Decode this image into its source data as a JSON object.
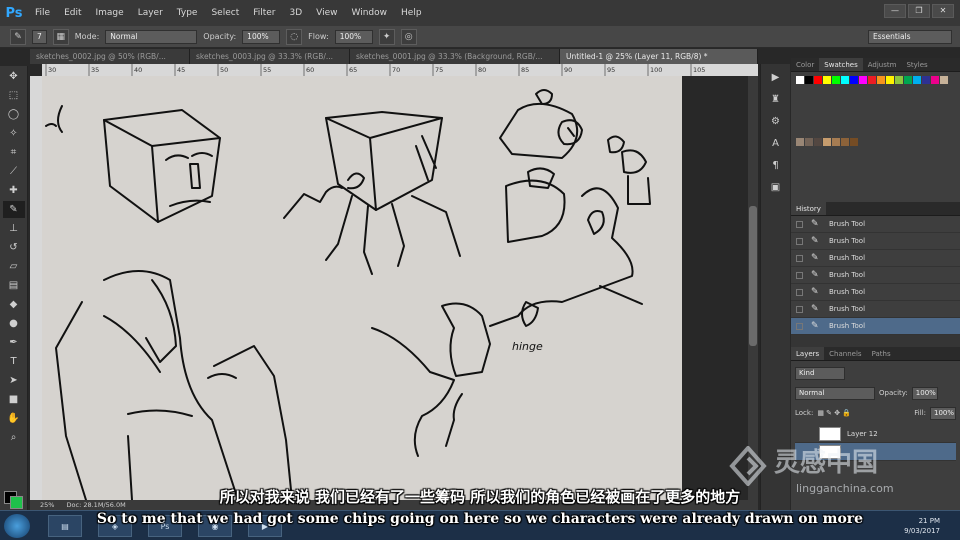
{
  "app": {
    "logo": "Ps"
  },
  "menu": [
    "File",
    "Edit",
    "Image",
    "Layer",
    "Type",
    "Select",
    "Filter",
    "3D",
    "View",
    "Window",
    "Help"
  ],
  "window_controls": [
    "—",
    "❐",
    "✕"
  ],
  "options": {
    "brush_size": "7",
    "mode_label": "Mode:",
    "mode_value": "Normal",
    "opacity_label": "Opacity:",
    "opacity_value": "100%",
    "flow_label": "Flow:",
    "flow_value": "100%",
    "workspace": "Essentials"
  },
  "tabs": [
    "sketches_0002.jpg @ 50% (RGB/...",
    "sketches_0003.jpg @ 33.3% (RGB/...",
    "sketches_0001.jpg @ 33.3% (Background, RGB/...",
    "Untitled-1 @ 25% (Layer 11, RGB/8) *"
  ],
  "ruler_ticks": [
    "30",
    "35",
    "40",
    "45",
    "50",
    "55",
    "60",
    "65",
    "70",
    "75",
    "80",
    "85",
    "90",
    "95",
    "100",
    "105"
  ],
  "status": {
    "zoom": "25%",
    "doc": "Doc: 28.1M/56.0M"
  },
  "panels": {
    "color_tabs": [
      "Color",
      "Swatches",
      "Adjustm",
      "Styles"
    ],
    "history_tab": "History",
    "history_items": [
      "Brush Tool",
      "Brush Tool",
      "Brush Tool",
      "Brush Tool",
      "Brush Tool",
      "Brush Tool",
      "Brush Tool"
    ],
    "layers_tabs": [
      "Layers",
      "Channels",
      "Paths"
    ],
    "layers_kind": "Kind",
    "layers_blend": "Normal",
    "layers_opacity_label": "Opacity:",
    "layers_opacity": "100%",
    "lock_label": "Lock:",
    "fill_label": "Fill:",
    "fill": "100%",
    "layer_name": "Layer 12"
  },
  "swatch_colors": [
    "#ffffff",
    "#000000",
    "#ff0000",
    "#ffff00",
    "#00ff00",
    "#00ffff",
    "#0000ff",
    "#ff00ff",
    "#ed1c24",
    "#f7941d",
    "#fff200",
    "#8dc63f",
    "#00a651",
    "#00aeef",
    "#2e3192",
    "#ec008c",
    "#c7b299",
    "#998675",
    "#736357",
    "#534741",
    "#c69c6d",
    "#a67c52",
    "#8c6239",
    "#754c24"
  ],
  "canvas_text": "hinge",
  "subtitles": {
    "chinese": "所以对我来说 我们已经有了一些筹码 所以我们的角色已经被画在了更多的地方",
    "english": "So to me that we had got some chips going on here so we characters were already drawn on more"
  },
  "taskbar": {
    "time": "21 PM",
    "date": "9/03/2017"
  },
  "watermark": {
    "text": "灵感中国",
    "url": "lingganchina.com"
  }
}
